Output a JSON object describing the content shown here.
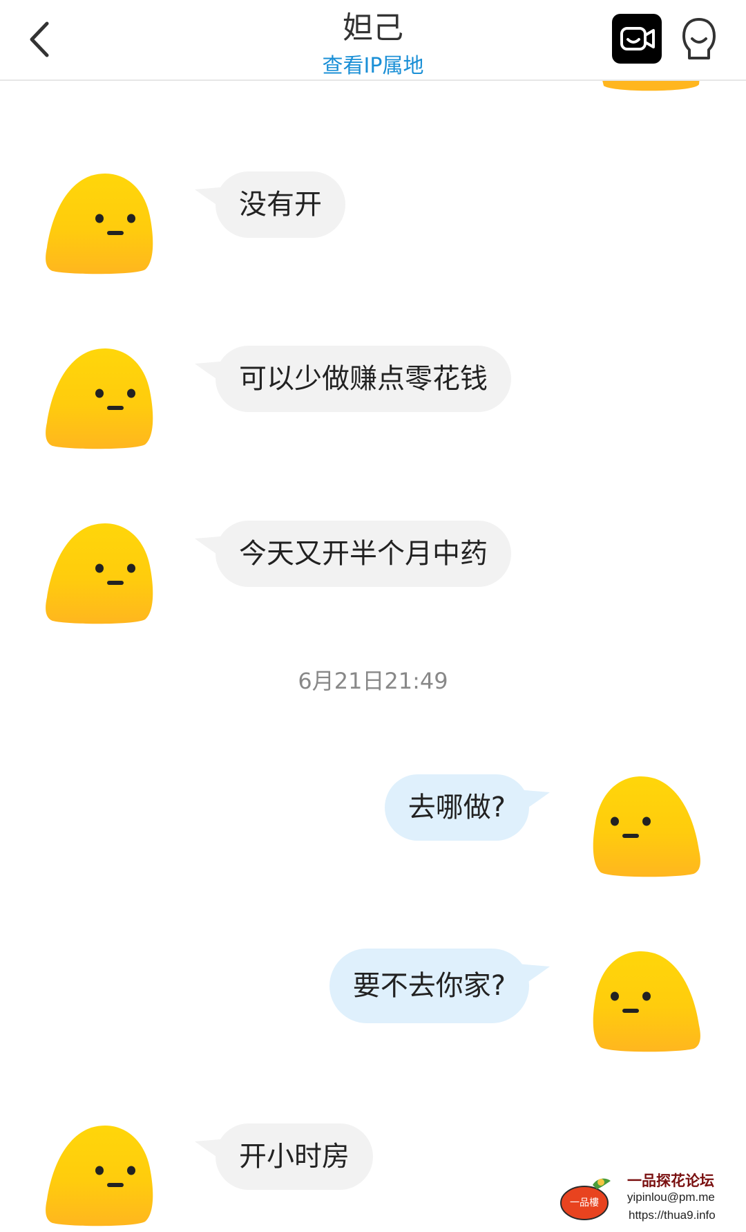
{
  "header": {
    "title": "妲己",
    "ip_link": "查看IP属地",
    "icons": {
      "back": "chevron-left-icon",
      "video": "video-call-icon",
      "profile": "profile-icon"
    }
  },
  "messages": [
    {
      "side": "incoming",
      "text": "没有开"
    },
    {
      "side": "incoming",
      "text": "可以少做赚点零花钱"
    },
    {
      "side": "incoming",
      "text": "今天又开半个月中药"
    },
    {
      "side": "outgoing",
      "text": "去哪做?"
    },
    {
      "side": "outgoing",
      "text": "要不去你家?"
    },
    {
      "side": "incoming",
      "text": "开小时房"
    }
  ],
  "timestamp": "6月21日21:49",
  "colors": {
    "incoming_bubble": "#f2f2f2",
    "outgoing_bubble": "#dff0fc",
    "link": "#1a8fd6",
    "avatar_top": "#ffd60a",
    "avatar_bottom": "#ffb61f"
  },
  "watermark": {
    "title": "一品探花论坛",
    "email": "yipinlou@pm.me",
    "url": "https://thua9.info",
    "logo_text": "一品樓"
  }
}
